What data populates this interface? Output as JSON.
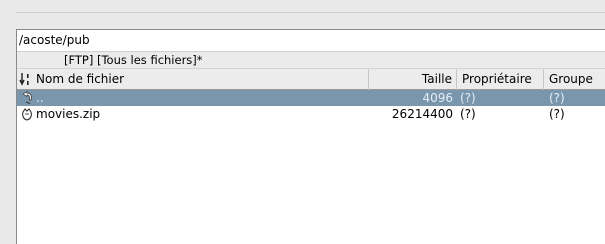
{
  "location": {
    "path": "/acoste/pub",
    "filter": "[FTP] [Tous les fichiers]*"
  },
  "columns": {
    "name": "Nom de fichier",
    "size": "Taille",
    "owner": "Propriétaire",
    "group": "Groupe"
  },
  "files": [
    {
      "icon": "parent-folder-icon",
      "name": "..",
      "size": "4096",
      "owner": "(?)",
      "group": "(?)",
      "selected": true
    },
    {
      "icon": "file-icon",
      "name": "movies.zip",
      "size": "26214400",
      "owner": "(?)",
      "group": "(?)",
      "selected": false
    }
  ],
  "colors": {
    "selection": "#7a96ad",
    "selection_text": "#e6edf4"
  }
}
